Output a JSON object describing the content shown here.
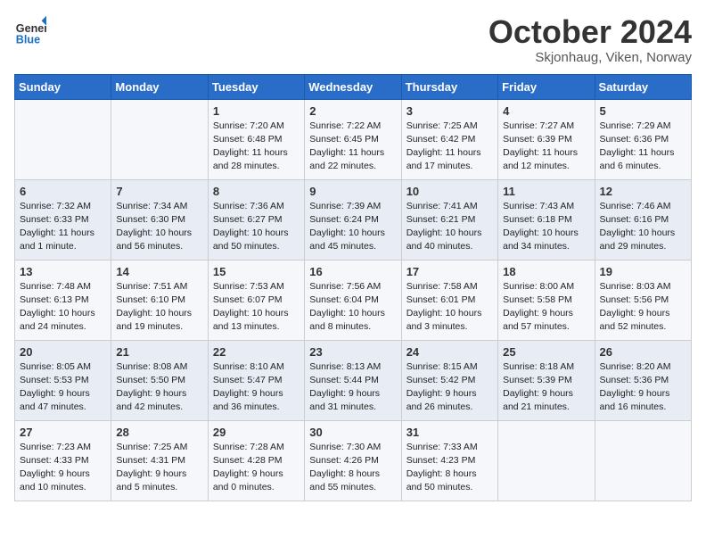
{
  "header": {
    "logo_line1": "General",
    "logo_line2": "Blue",
    "month": "October 2024",
    "location": "Skjonhaug, Viken, Norway"
  },
  "days_of_week": [
    "Sunday",
    "Monday",
    "Tuesday",
    "Wednesday",
    "Thursday",
    "Friday",
    "Saturday"
  ],
  "weeks": [
    [
      {
        "day": "",
        "info": ""
      },
      {
        "day": "",
        "info": ""
      },
      {
        "day": "1",
        "info": "Sunrise: 7:20 AM\nSunset: 6:48 PM\nDaylight: 11 hours and 28 minutes."
      },
      {
        "day": "2",
        "info": "Sunrise: 7:22 AM\nSunset: 6:45 PM\nDaylight: 11 hours and 22 minutes."
      },
      {
        "day": "3",
        "info": "Sunrise: 7:25 AM\nSunset: 6:42 PM\nDaylight: 11 hours and 17 minutes."
      },
      {
        "day": "4",
        "info": "Sunrise: 7:27 AM\nSunset: 6:39 PM\nDaylight: 11 hours and 12 minutes."
      },
      {
        "day": "5",
        "info": "Sunrise: 7:29 AM\nSunset: 6:36 PM\nDaylight: 11 hours and 6 minutes."
      }
    ],
    [
      {
        "day": "6",
        "info": "Sunrise: 7:32 AM\nSunset: 6:33 PM\nDaylight: 11 hours and 1 minute."
      },
      {
        "day": "7",
        "info": "Sunrise: 7:34 AM\nSunset: 6:30 PM\nDaylight: 10 hours and 56 minutes."
      },
      {
        "day": "8",
        "info": "Sunrise: 7:36 AM\nSunset: 6:27 PM\nDaylight: 10 hours and 50 minutes."
      },
      {
        "day": "9",
        "info": "Sunrise: 7:39 AM\nSunset: 6:24 PM\nDaylight: 10 hours and 45 minutes."
      },
      {
        "day": "10",
        "info": "Sunrise: 7:41 AM\nSunset: 6:21 PM\nDaylight: 10 hours and 40 minutes."
      },
      {
        "day": "11",
        "info": "Sunrise: 7:43 AM\nSunset: 6:18 PM\nDaylight: 10 hours and 34 minutes."
      },
      {
        "day": "12",
        "info": "Sunrise: 7:46 AM\nSunset: 6:16 PM\nDaylight: 10 hours and 29 minutes."
      }
    ],
    [
      {
        "day": "13",
        "info": "Sunrise: 7:48 AM\nSunset: 6:13 PM\nDaylight: 10 hours and 24 minutes."
      },
      {
        "day": "14",
        "info": "Sunrise: 7:51 AM\nSunset: 6:10 PM\nDaylight: 10 hours and 19 minutes."
      },
      {
        "day": "15",
        "info": "Sunrise: 7:53 AM\nSunset: 6:07 PM\nDaylight: 10 hours and 13 minutes."
      },
      {
        "day": "16",
        "info": "Sunrise: 7:56 AM\nSunset: 6:04 PM\nDaylight: 10 hours and 8 minutes."
      },
      {
        "day": "17",
        "info": "Sunrise: 7:58 AM\nSunset: 6:01 PM\nDaylight: 10 hours and 3 minutes."
      },
      {
        "day": "18",
        "info": "Sunrise: 8:00 AM\nSunset: 5:58 PM\nDaylight: 9 hours and 57 minutes."
      },
      {
        "day": "19",
        "info": "Sunrise: 8:03 AM\nSunset: 5:56 PM\nDaylight: 9 hours and 52 minutes."
      }
    ],
    [
      {
        "day": "20",
        "info": "Sunrise: 8:05 AM\nSunset: 5:53 PM\nDaylight: 9 hours and 47 minutes."
      },
      {
        "day": "21",
        "info": "Sunrise: 8:08 AM\nSunset: 5:50 PM\nDaylight: 9 hours and 42 minutes."
      },
      {
        "day": "22",
        "info": "Sunrise: 8:10 AM\nSunset: 5:47 PM\nDaylight: 9 hours and 36 minutes."
      },
      {
        "day": "23",
        "info": "Sunrise: 8:13 AM\nSunset: 5:44 PM\nDaylight: 9 hours and 31 minutes."
      },
      {
        "day": "24",
        "info": "Sunrise: 8:15 AM\nSunset: 5:42 PM\nDaylight: 9 hours and 26 minutes."
      },
      {
        "day": "25",
        "info": "Sunrise: 8:18 AM\nSunset: 5:39 PM\nDaylight: 9 hours and 21 minutes."
      },
      {
        "day": "26",
        "info": "Sunrise: 8:20 AM\nSunset: 5:36 PM\nDaylight: 9 hours and 16 minutes."
      }
    ],
    [
      {
        "day": "27",
        "info": "Sunrise: 7:23 AM\nSunset: 4:33 PM\nDaylight: 9 hours and 10 minutes."
      },
      {
        "day": "28",
        "info": "Sunrise: 7:25 AM\nSunset: 4:31 PM\nDaylight: 9 hours and 5 minutes."
      },
      {
        "day": "29",
        "info": "Sunrise: 7:28 AM\nSunset: 4:28 PM\nDaylight: 9 hours and 0 minutes."
      },
      {
        "day": "30",
        "info": "Sunrise: 7:30 AM\nSunset: 4:26 PM\nDaylight: 8 hours and 55 minutes."
      },
      {
        "day": "31",
        "info": "Sunrise: 7:33 AM\nSunset: 4:23 PM\nDaylight: 8 hours and 50 minutes."
      },
      {
        "day": "",
        "info": ""
      },
      {
        "day": "",
        "info": ""
      }
    ]
  ]
}
